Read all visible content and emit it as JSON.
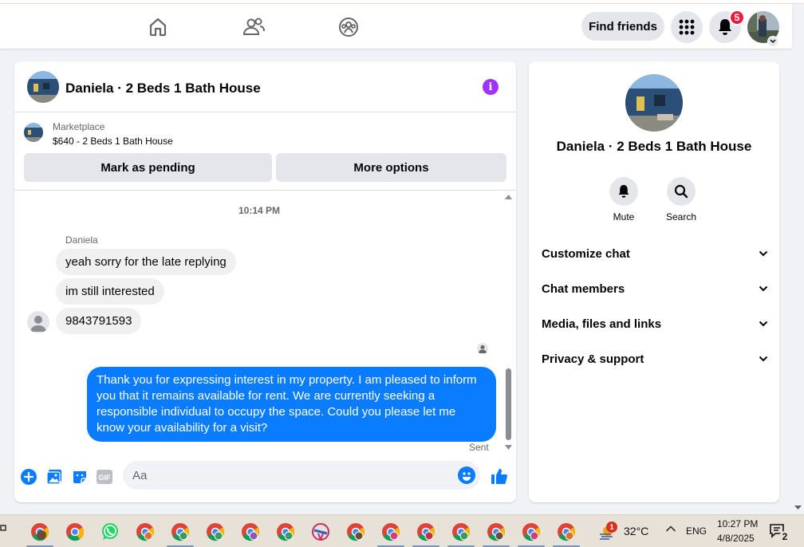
{
  "header": {
    "find_friends_label": "Find friends",
    "notification_count": "5"
  },
  "chat": {
    "title": "Daniela · 2 Beds 1 Bath House",
    "marketplace_label": "Marketplace",
    "listing": "$640 - 2 Beds 1 Bath House",
    "mark_pending_label": "Mark as pending",
    "more_options_label": "More options",
    "timestamp": "10:14 PM",
    "sender_name": "Daniela",
    "incoming": [
      "yeah sorry for the late replying",
      "im still interested",
      "9843791593"
    ],
    "outgoing": "Thank you for expressing interest in my property. I am pleased to inform you that it remains available for rent. We are currently seeking a responsible individual to occupy the space. Could you please let me know your availability for a visit?",
    "status": "Sent",
    "composer_placeholder": "Aa",
    "gif_label": "GIF"
  },
  "side_panel": {
    "title": "Daniela · 2 Beds 1 Bath House",
    "actions": [
      {
        "label": "Mute",
        "icon": "bell-icon"
      },
      {
        "label": "Search",
        "icon": "search-icon"
      }
    ],
    "sections": [
      "Customize chat",
      "Chat members",
      "Media, files and links",
      "Privacy & support"
    ]
  },
  "taskbar": {
    "temperature": "32°C",
    "language": "ENG",
    "time": "10:27 PM",
    "date": "4/8/2025",
    "notification_count": "2",
    "weather_alert": "1"
  },
  "colors": {
    "accent": "#0a7cff",
    "info": "#a033ff",
    "badge": "#e41e3f"
  }
}
